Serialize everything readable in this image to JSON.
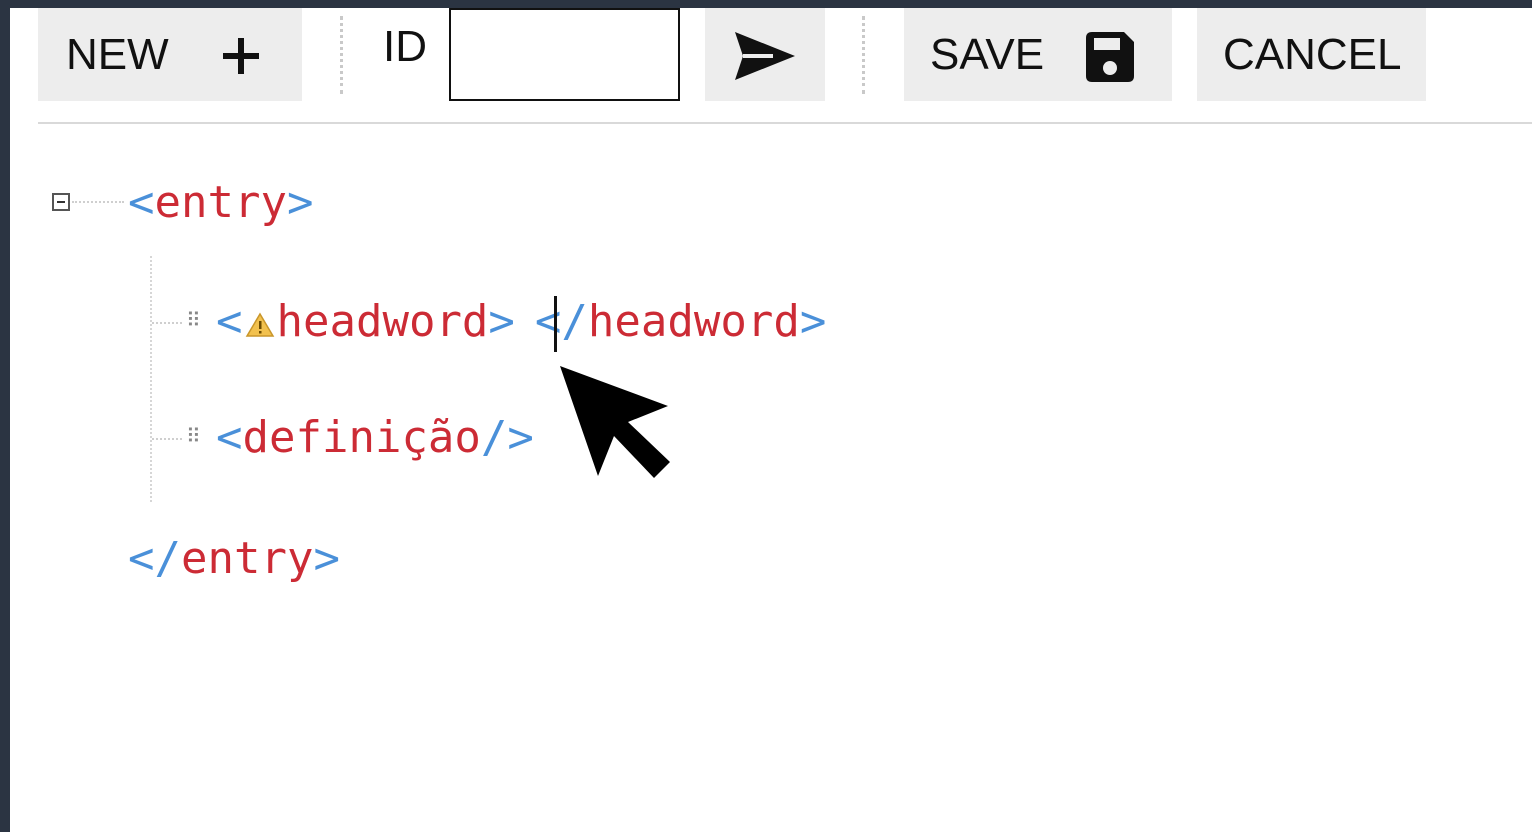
{
  "toolbar": {
    "new_label": "NEW",
    "new_icon": "plus-icon",
    "id_label": "ID",
    "id_value": "",
    "go_icon": "send-arrow-icon",
    "save_label": "SAVE",
    "save_icon": "floppy-disk-icon",
    "cancel_label": "CANCEL"
  },
  "editor": {
    "entry_open": {
      "lt": "<",
      "name": "entry",
      "gt": ">"
    },
    "headword": {
      "lt": "<",
      "warning_icon": "warning-icon",
      "name": "headword",
      "gt": ">",
      "close_lt": "</",
      "close_name": "headword",
      "close_gt": ">"
    },
    "definicao": {
      "lt": "<",
      "name": "definição",
      "gt": "/>"
    },
    "entry_close": {
      "lt": "</",
      "name": "entry",
      "gt": ">"
    }
  },
  "colors": {
    "punctuation": "#4a90d9",
    "tag_name": "#cc2b35",
    "toolbar_button": "#ededed",
    "frame": "#2b3442"
  }
}
